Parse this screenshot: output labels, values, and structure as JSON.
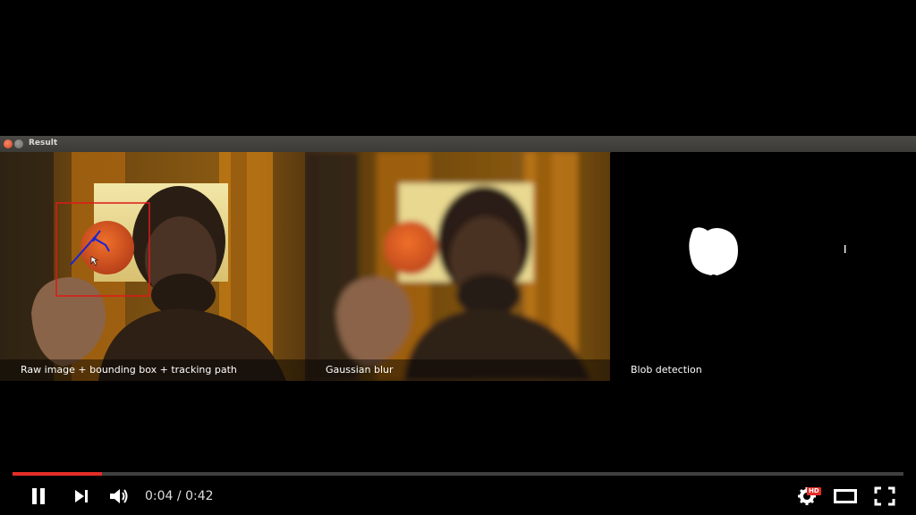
{
  "window": {
    "title": "Result"
  },
  "panels": [
    {
      "caption": "Raw image + bounding box + tracking path"
    },
    {
      "caption": "Gaussian blur"
    },
    {
      "caption": "Blob detection"
    }
  ],
  "player": {
    "current_time": "0:04",
    "separator": "/",
    "duration": "0:42",
    "played_fraction": 0.1,
    "loaded_fraction": 0.1,
    "hd_badge": "HD"
  },
  "colors": {
    "accent": "#e52d27",
    "bbox": "#e01818",
    "track": "#1a22d8"
  },
  "icons": [
    "pause-icon",
    "next-icon",
    "volume-icon",
    "settings-icon",
    "theater-icon",
    "fullscreen-icon"
  ]
}
